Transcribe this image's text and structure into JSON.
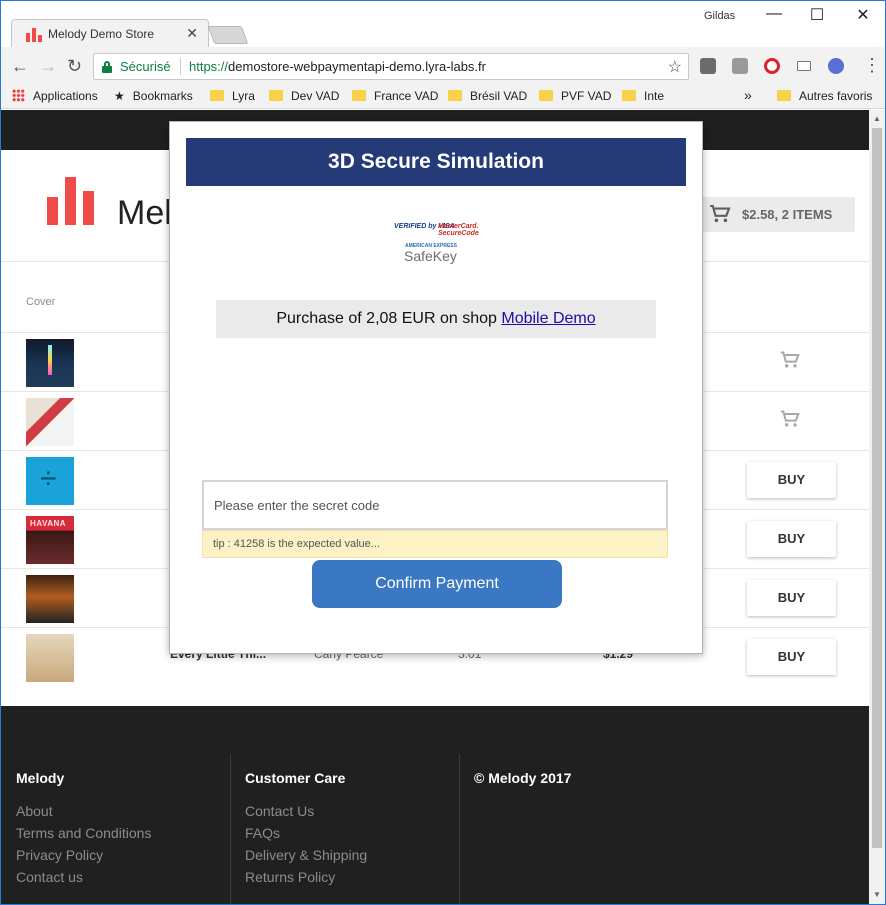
{
  "browser": {
    "tab_title": "Melody Demo Store",
    "tab_close": "✕",
    "user": "Gildas",
    "win_minimize": "—",
    "win_maximize": "☐",
    "win_close": "✕",
    "back": "←",
    "forward": "→",
    "reload": "↻",
    "secure_label": "Sécurisé",
    "url_scheme": "https://",
    "url_rest": "demostore-webpaymentapi-demo.lyra-labs.fr",
    "star": "☆",
    "more_bookmarks": "»",
    "bookmarks": [
      "Applications",
      "Bookmarks",
      "Lyra",
      "Dev VAD",
      "France VAD",
      "Brésil VAD",
      "PVF VAD",
      "Inte",
      "Autres favoris"
    ]
  },
  "store": {
    "brand_visible": "Mel",
    "cart_label": "$2.58, 2 ITEMS",
    "cover_header": "Cover",
    "buy_label": "BUY",
    "last_row": {
      "title": "Every Little Thi...",
      "artist": "Carly Pearce",
      "duration": "3:01",
      "price": "$1.29"
    }
  },
  "modal": {
    "title": "3D Secure Simulation",
    "logo_vbv": "VERIFIED by VISA",
    "logo_msc": "MasterCard. SecureCode",
    "logo_amex": "AMERICAN EXPRESS",
    "logo_safekey": "SafeKey",
    "purchase_prefix": "Purchase of 2,08 EUR on shop ",
    "shop_name": "Mobile Demo",
    "code_placeholder": "Please enter the secret code",
    "tip": "tip : 41258 is the expected value...",
    "confirm_label": "Confirm Payment"
  },
  "footer": {
    "col1_title": "Melody",
    "col1_links": [
      "About",
      "Terms and Conditions",
      "Privacy Policy",
      "Contact us"
    ],
    "col2_title": "Customer Care",
    "col2_links": [
      "Contact Us",
      "FAQs",
      "Delivery & Shipping",
      "Returns Policy"
    ],
    "col3_title": "© Melody 2017"
  },
  "colors": {
    "accent_red": "#f04b4b",
    "modal_header": "#253b78",
    "confirm_button": "#3a78c3",
    "tip_background": "#fdf1c6",
    "footer_background": "#202020"
  }
}
